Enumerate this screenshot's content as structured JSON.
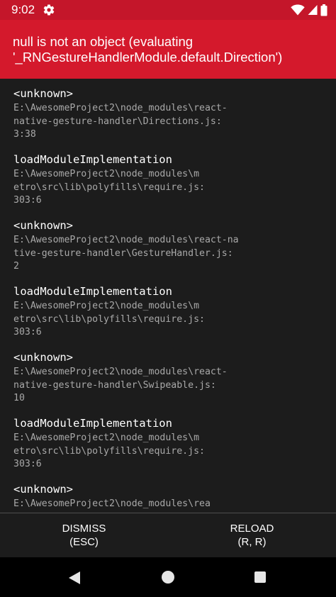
{
  "status_bar": {
    "time": "9:02",
    "icons": [
      "gear-icon",
      "wifi-icon",
      "cellular-icon",
      "battery-icon"
    ]
  },
  "error": {
    "message_line1": "null is not an object (evaluating",
    "message_line2": "'_RNGestureHandlerModule.default.Direction')"
  },
  "stack": [
    {
      "name": "<unknown>",
      "path": "E:\\AwesomeProject2\\node_modules\\react-\nnative-gesture-handler\\Directions.js:\n3:38"
    },
    {
      "name": "loadModuleImplementation",
      "path": "E:\\AwesomeProject2\\node_modules\\m\netro\\src\\lib\\polyfills\\require.js:\n303:6"
    },
    {
      "name": "<unknown>",
      "path": "E:\\AwesomeProject2\\node_modules\\react-na\ntive-gesture-handler\\GestureHandler.js:\n2"
    },
    {
      "name": "loadModuleImplementation",
      "path": "E:\\AwesomeProject2\\node_modules\\m\netro\\src\\lib\\polyfills\\require.js:\n303:6"
    },
    {
      "name": "<unknown>",
      "path": "E:\\AwesomeProject2\\node_modules\\react-\nnative-gesture-handler\\Swipeable.js:\n10"
    },
    {
      "name": "loadModuleImplementation",
      "path": "E:\\AwesomeProject2\\node_modules\\m\netro\\src\\lib\\polyfills\\require.js:\n303:6"
    },
    {
      "name": "<unknown>",
      "path": "E:\\AwesomeProject2\\node_modules\\rea"
    }
  ],
  "buttons": {
    "dismiss_label": "DISMISS",
    "dismiss_hint": "(ESC)",
    "reload_label": "RELOAD",
    "reload_hint": "(R, R)"
  },
  "nav_bar": {
    "icons": [
      "back-icon",
      "home-icon",
      "recents-icon"
    ]
  },
  "colors": {
    "status_bar": "#c4162a",
    "error_header": "#d4192c",
    "stack_background": "#1c1c1c",
    "frame_name": "#ffffff",
    "frame_path": "#a9a9a9"
  }
}
